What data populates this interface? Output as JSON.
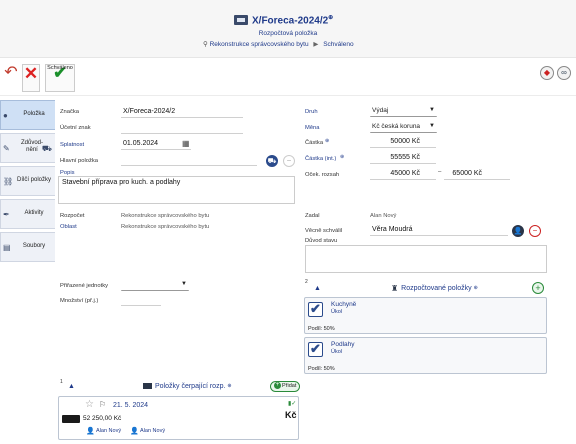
{
  "header": {
    "title": "X/Foreca-2024/2",
    "title_mark": "⊕",
    "subtitle": "Rozpočtová položka",
    "breadcrumb_project": "Rekonstrukce správcovského bytu",
    "breadcrumb_status": "Schváleno"
  },
  "toolbar": {
    "save_label": "Schváleno"
  },
  "tabs": [
    {
      "label": "Položka",
      "icon": "bullet-icon"
    },
    {
      "label": "Zdůvod-nění",
      "icon": "pencil-icon"
    },
    {
      "label": "Dílčí položky",
      "icon": "link-icon"
    },
    {
      "label": "Aktivity",
      "icon": "pen-icon"
    },
    {
      "label": "Soubory",
      "icon": "book-icon"
    }
  ],
  "form": {
    "znacka_label": "Značka",
    "znacka": "X/Foreca-2024/2",
    "ucetni_label": "Účetní znak",
    "splatnost_label": "Splatnost",
    "splatnost": "01.05.2024",
    "hlavni_label": "Hlavní položka",
    "popis_label": "Popis",
    "popis": "Stavební příprava pro kuch. a podlahy",
    "druh_label": "Druh",
    "druh": "Výdaj",
    "mena_label": "Měna",
    "mena": "Kč česká koruna",
    "castka_label": "Částka",
    "castka": "50000 Kč",
    "castka_int_label": "Částka (int.)",
    "castka_int": "55555 Kč",
    "ocek_label": "Oček. rozsah",
    "ocek_from": "45000 Kč",
    "ocek_dash": "–",
    "ocek_to": "65000 Kč",
    "rozpocet_label": "Rozpočet",
    "rozpocet": "Rekonstrukce správcovského bytu",
    "oblast_label": "Oblast",
    "oblast": "Rekonstrukce správcovského bytu",
    "zadal_label": "Zadal",
    "zadal": "Alan Nový",
    "vecne_label": "Věcně schválil",
    "vecne": "Věra Moudrá",
    "duvod_label": "Důvod stavu",
    "prirazene_label": "Přiřazené jednotky",
    "mnozstvi_label": "Množství (př.j.)"
  },
  "budgeted": {
    "count": "2",
    "title": "Rozpočtované položky",
    "items": [
      {
        "name": "Kuchyně",
        "type": "Úkol",
        "share": "Podíl: 50%"
      },
      {
        "name": "Podlahy",
        "type": "Úkol",
        "share": "Podíl: 50%"
      }
    ]
  },
  "drawing": {
    "count": "1",
    "title": "Položky čerpající rozp.",
    "add_label": "Přidat",
    "item": {
      "date": "21. 5. 2024",
      "amount": "52 250,00 Kč",
      "currency": "Kč",
      "person1": "Alan Nový",
      "person2": "Alan Nový"
    }
  }
}
